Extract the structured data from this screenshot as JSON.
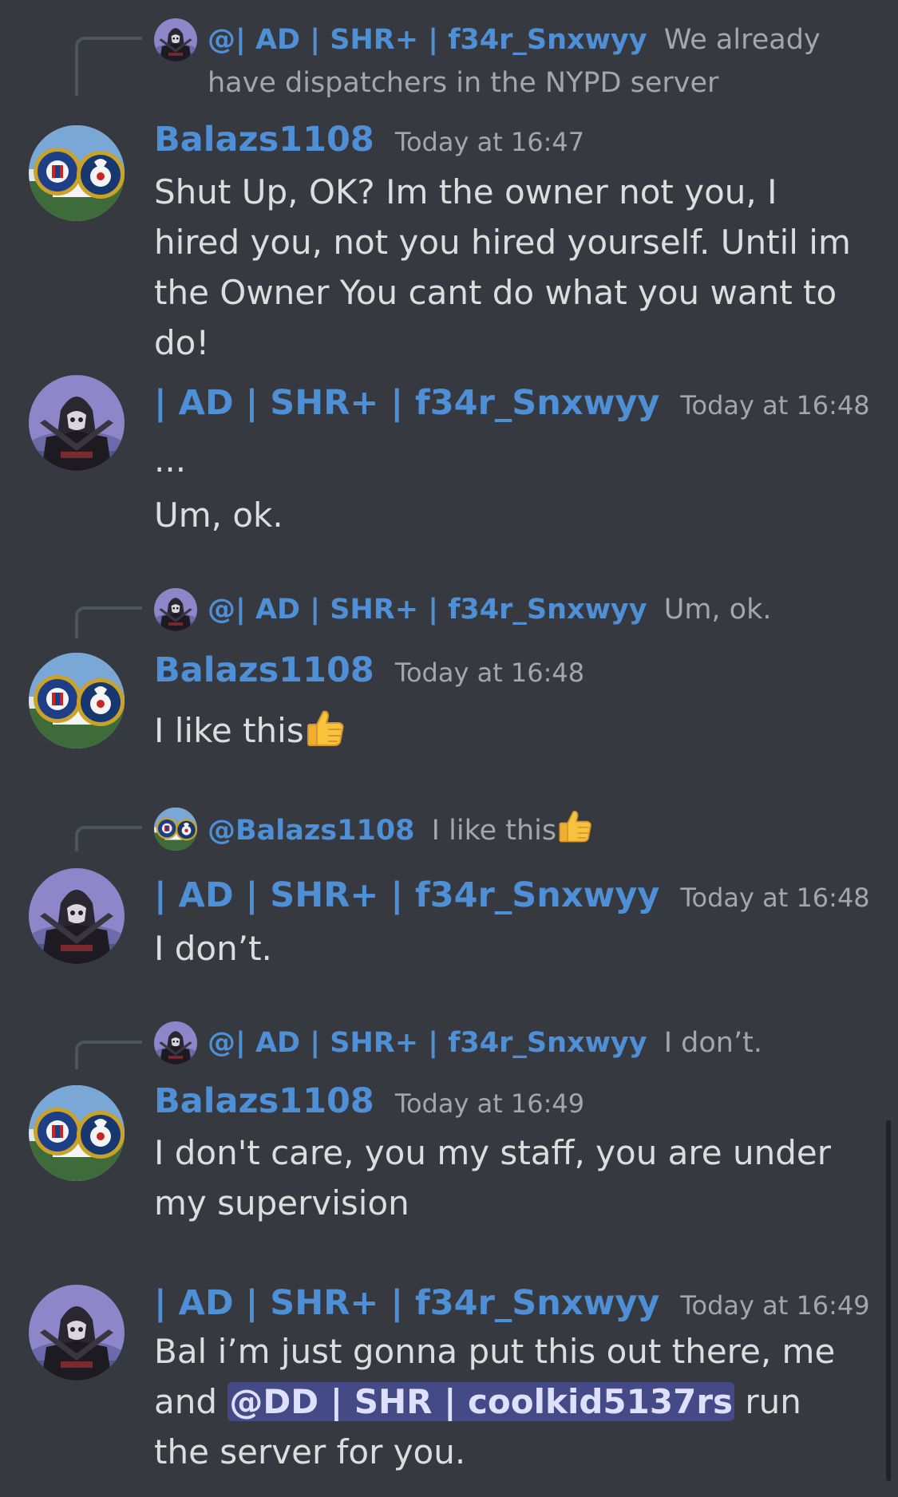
{
  "messages": [
    {
      "reply": {
        "name": "@| AD | SHR+ | f34r_Snxwyy",
        "text": "We already have dispatchers in the NYPD server"
      },
      "author": "Balazs1108",
      "avatar": "agency-seals-avatar",
      "timestamp": "Today at 16:47",
      "lines": [
        "Shut Up, OK? Im the owner not you, I hired you, not you hired yourself. Until im the Owner You cant do what you want to do!"
      ]
    },
    {
      "author": "| AD | SHR+ | f34r_Snxwyy",
      "avatar": "hooded-reaper-avatar",
      "timestamp": "Today at 16:48",
      "lines": [
        "...",
        "Um, ok."
      ]
    },
    {
      "reply": {
        "name": "@| AD | SHR+ | f34r_Snxwyy",
        "text": "Um, ok."
      },
      "author": "Balazs1108",
      "avatar": "agency-seals-avatar",
      "timestamp": "Today at 16:48",
      "text": "I like this",
      "emoji": "thumbs-up-emoji"
    },
    {
      "reply": {
        "name": "@Balazs1108",
        "text": "I like this",
        "emoji": "thumbs-up-emoji"
      },
      "author": "| AD | SHR+ | f34r_Snxwyy",
      "avatar": "hooded-reaper-avatar",
      "timestamp": "Today at 16:48",
      "text": "I don’t."
    },
    {
      "reply": {
        "name": "@| AD | SHR+ | f34r_Snxwyy",
        "text": "I don’t."
      },
      "author": "Balazs1108",
      "avatar": "agency-seals-avatar",
      "timestamp": "Today at 16:49",
      "text": "I don't care, you my staff, you are under my supervision"
    },
    {
      "author": "| AD | SHR+ | f34r_Snxwyy",
      "avatar": "hooded-reaper-avatar",
      "timestamp": "Today at 16:49",
      "text_before": "Bal i’m just gonna put this out there, me and",
      "mention": "@DD | SHR | coolkid5137rs",
      "text_after": "run the server for you."
    }
  ],
  "colors": {
    "background": "#36393f",
    "username": "#4f8fd6",
    "message_text": "#dcddde",
    "timestamp": "#a3a6aa",
    "mention_bg": "#5865f266"
  }
}
